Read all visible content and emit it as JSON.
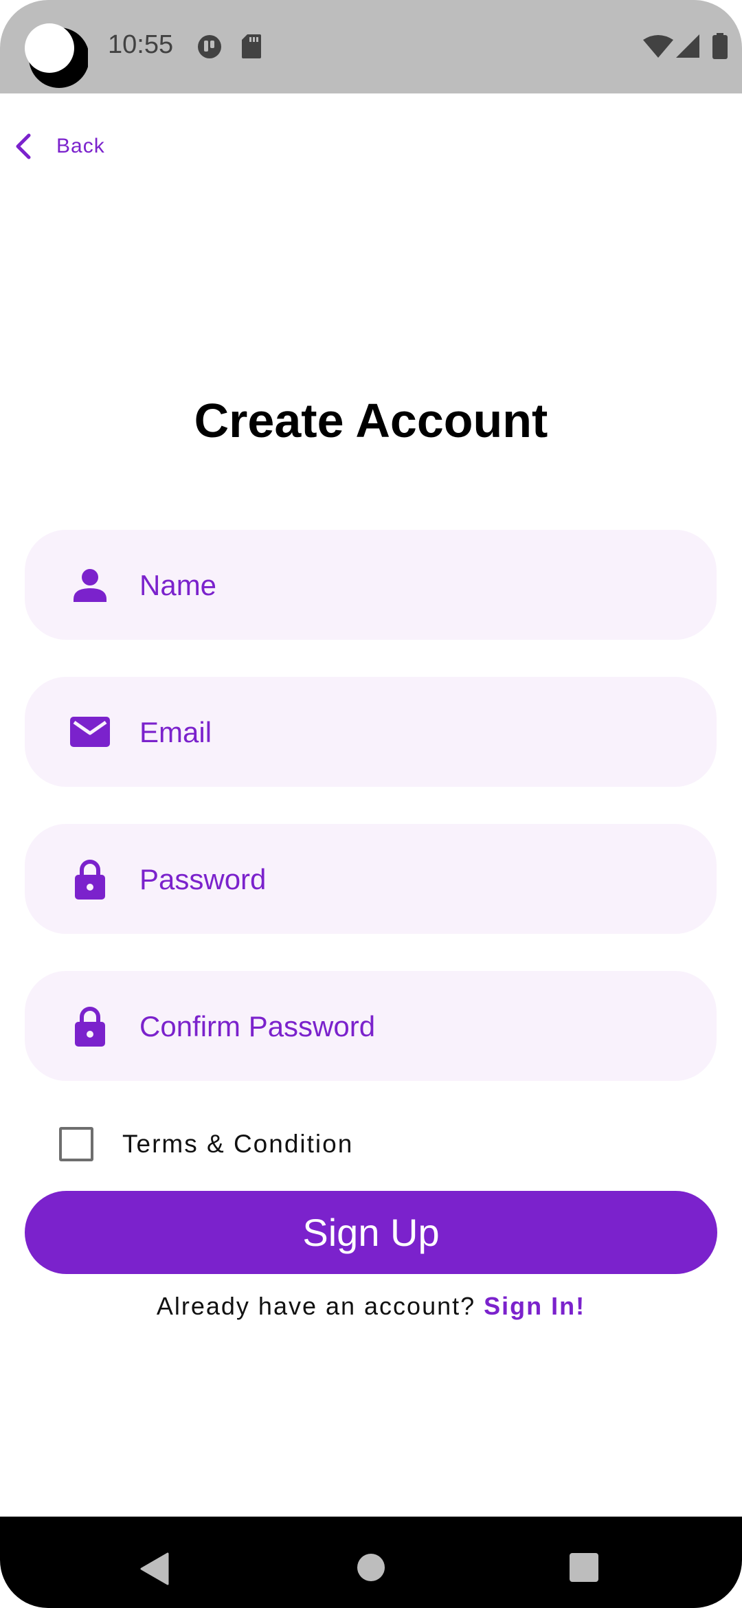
{
  "status_bar": {
    "time": "10:55",
    "icons": [
      "app-notification-icon",
      "sd-card-icon",
      "wifi-icon",
      "cell-signal-icon",
      "battery-icon"
    ]
  },
  "back": {
    "label": "Back",
    "icon": "chevron-left-icon"
  },
  "page": {
    "title": "Create Account"
  },
  "form": {
    "name": {
      "placeholder": "Name",
      "value": "",
      "icon": "person-icon"
    },
    "email": {
      "placeholder": "Email",
      "value": "",
      "icon": "mail-icon"
    },
    "password": {
      "placeholder": "Password",
      "value": "",
      "icon": "lock-icon"
    },
    "confirm_password": {
      "placeholder": "Confirm Password",
      "value": "",
      "icon": "lock-icon"
    },
    "terms_label": "Terms & Condition",
    "terms_checked": false,
    "signup_label": "Sign Up",
    "already_text": "Already have an account?",
    "signin_label": "Sign In!"
  },
  "nav_bar": {
    "buttons": [
      "back-triangle-icon",
      "home-circle-icon",
      "recents-square-icon"
    ]
  },
  "colors": {
    "accent": "#7b22cc",
    "field_bg": "#f9f2fc",
    "status_bar_bg": "#bdbdbd",
    "nav_bar_bg": "#000000"
  }
}
